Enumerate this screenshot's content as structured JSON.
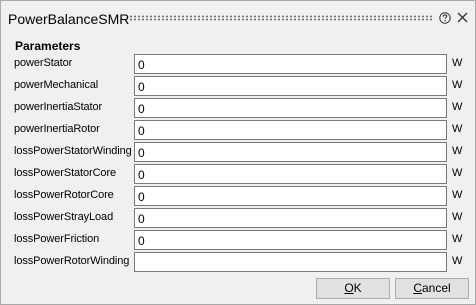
{
  "window": {
    "title": "PowerBalanceSMR",
    "icons": [
      "help-icon",
      "close-icon"
    ]
  },
  "parameters": {
    "heading": "Parameters",
    "rows": [
      {
        "label": "powerStator",
        "value": "0",
        "unit": "W"
      },
      {
        "label": "powerMechanical",
        "value": "0",
        "unit": "W"
      },
      {
        "label": "powerInertiaStator",
        "value": "0",
        "unit": "W"
      },
      {
        "label": "powerInertiaRotor",
        "value": "0",
        "unit": "W"
      },
      {
        "label": "lossPowerStatorWinding",
        "value": "0",
        "unit": "W"
      },
      {
        "label": "lossPowerStatorCore",
        "value": "0",
        "unit": "W"
      },
      {
        "label": "lossPowerRotorCore",
        "value": "0",
        "unit": "W"
      },
      {
        "label": "lossPowerStrayLoad",
        "value": "0",
        "unit": "W"
      },
      {
        "label": "lossPowerFriction",
        "value": "0",
        "unit": "W"
      },
      {
        "label": "lossPowerRotorWinding",
        "value": "",
        "unit": "W"
      }
    ]
  },
  "buttons": {
    "ok": {
      "mnemonic": "O",
      "rest": "K"
    },
    "cancel": {
      "mnemonic": "C",
      "rest": "ancel"
    }
  }
}
